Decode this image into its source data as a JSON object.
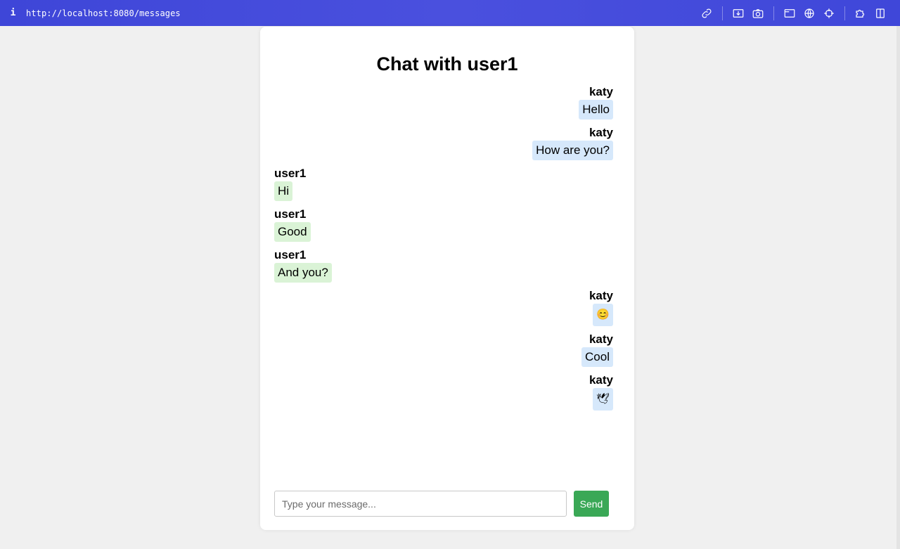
{
  "browser": {
    "info_glyph": "i",
    "url": "http://localhost:8080/messages"
  },
  "chat": {
    "title": "Chat with user1",
    "messages": [
      {
        "sender": "katy",
        "text": "Hello",
        "direction": "sent"
      },
      {
        "sender": "katy",
        "text": "How are you?",
        "direction": "sent"
      },
      {
        "sender": "user1",
        "text": "Hi",
        "direction": "received"
      },
      {
        "sender": "user1",
        "text": "Good",
        "direction": "received"
      },
      {
        "sender": "user1",
        "text": "And you?",
        "direction": "received"
      },
      {
        "sender": "katy",
        "text": "😊",
        "direction": "sent"
      },
      {
        "sender": "katy",
        "text": "Cool",
        "direction": "sent"
      },
      {
        "sender": "katy",
        "text": "🕊",
        "direction": "sent"
      }
    ],
    "composer": {
      "placeholder": "Type your message...",
      "send_label": "Send"
    }
  },
  "colors": {
    "toolbar": "#4349dc",
    "sent_bubble": "#d6e8fb",
    "received_bubble": "#daf3d6",
    "send_button": "#3aa856"
  }
}
